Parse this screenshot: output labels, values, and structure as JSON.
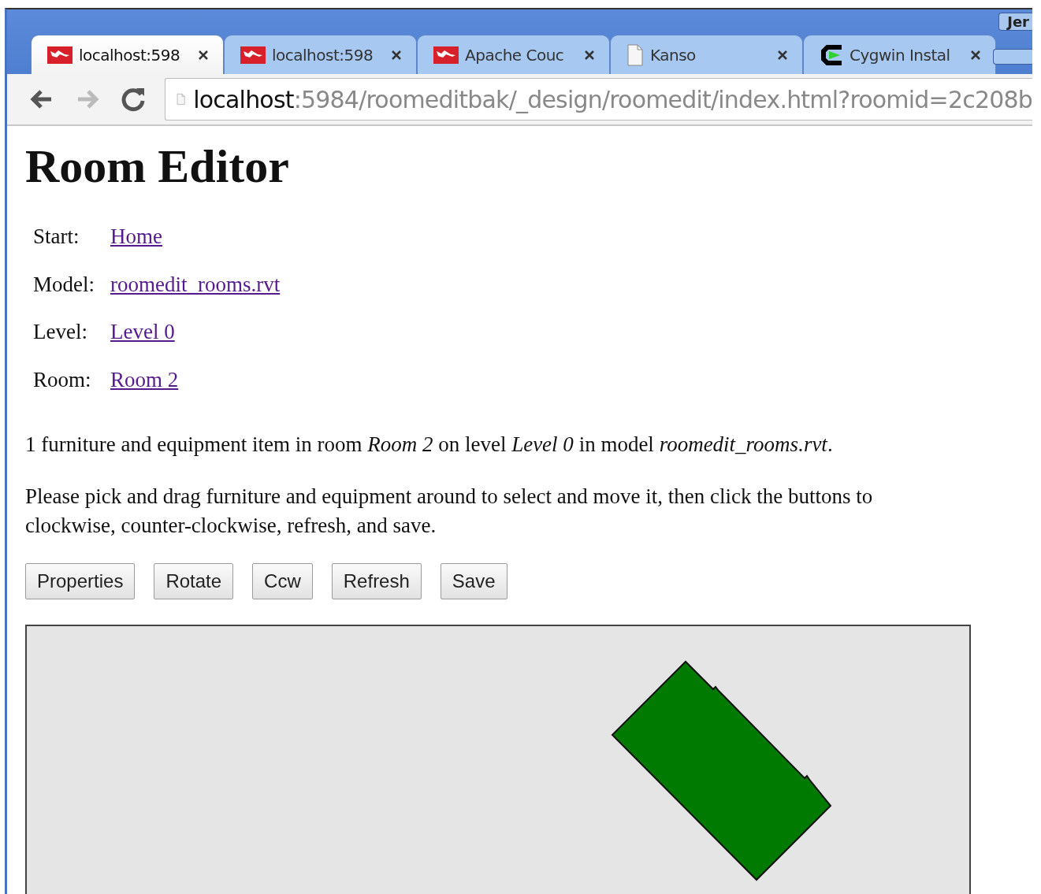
{
  "browser": {
    "tabs": [
      {
        "title": "localhost:598",
        "selected": true
      },
      {
        "title": "localhost:598",
        "selected": false
      },
      {
        "title": "Apache Couc",
        "selected": false
      },
      {
        "title": "Kanso",
        "selected": false
      },
      {
        "title": "Cygwin Instal",
        "selected": false
      }
    ],
    "user": "Jer",
    "address": {
      "host": "localhost",
      "path": ":5984/roomeditbak/_design/roomedit/index.html?roomid=2c208b"
    }
  },
  "heading": "Room Editor",
  "breadcrumbs": [
    {
      "label": "Start:",
      "link": "Home"
    },
    {
      "label": "Model:",
      "link": "roomedit_rooms.rvt"
    },
    {
      "label": "Level:",
      "link": "Level 0"
    },
    {
      "label": "Room:",
      "link": "Room 2"
    }
  ],
  "summary": "1 furniture and equipment item in room *Room 2* on level *Level 0* in model *roomedit_rooms.rvt*.",
  "instructions": [
    "Please pick and drag furniture and equipment around to select and move it, then click the buttons to",
    "clockwise, counter-clockwise, refresh, and save."
  ],
  "buttons": [
    "Properties",
    "Rotate",
    "Ccw",
    "Refresh",
    "Save"
  ]
}
